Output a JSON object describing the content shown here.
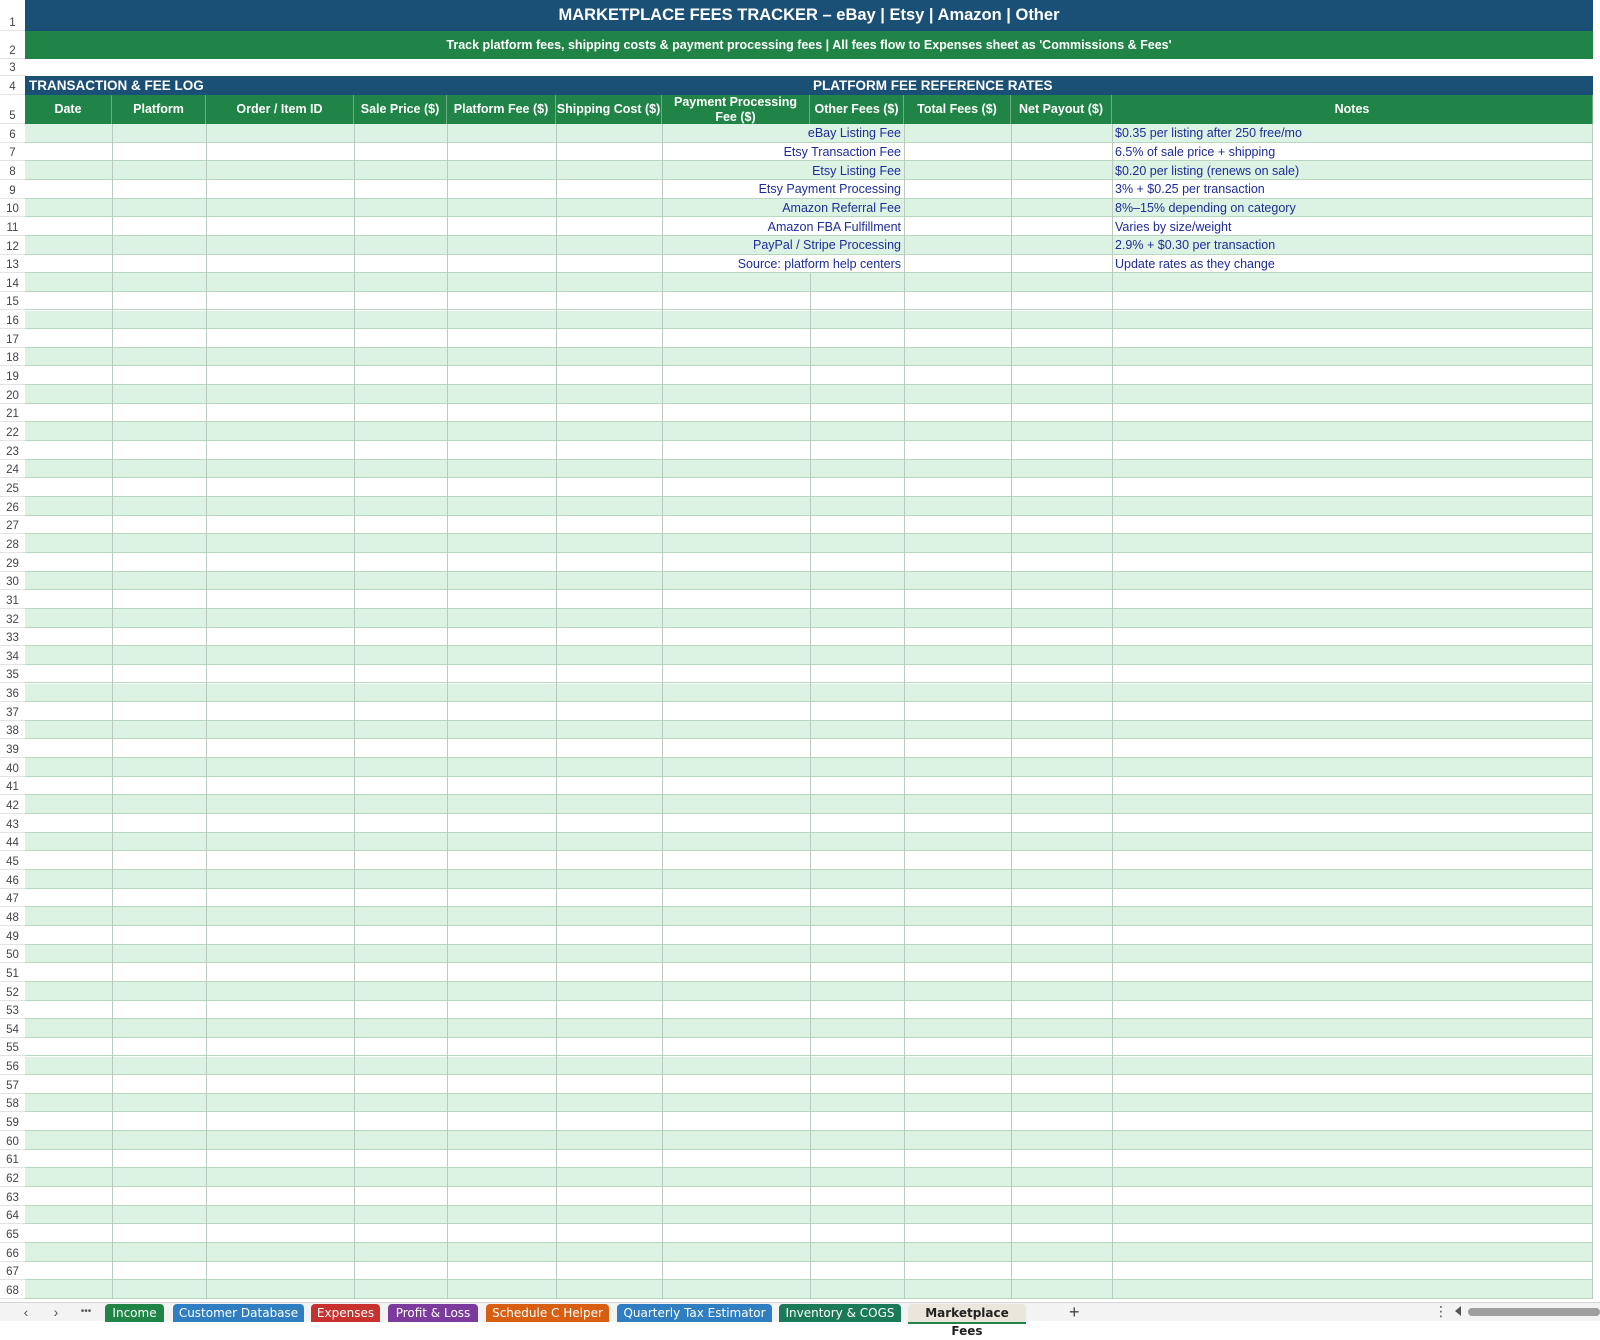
{
  "sheet": {
    "title": "MARKETPLACE FEES TRACKER – eBay | Etsy | Amazon | Other",
    "subtitle": "Track platform fees, shipping costs & payment processing fees  |  All fees flow to Expenses sheet as 'Commissions & Fees'",
    "section_left": "TRANSACTION & FEE LOG",
    "section_right": "PLATFORM FEE REFERENCE RATES",
    "columns": [
      "Date",
      "Platform",
      "Order / Item ID",
      "Sale Price ($)",
      "Platform Fee ($)",
      "Shipping Cost ($)",
      "Payment Processing Fee ($)",
      "Other Fees ($)",
      "Total Fees ($)",
      "Net Payout ($)",
      "Notes"
    ],
    "reference": [
      {
        "label": "eBay Listing Fee",
        "note": "$0.35 per listing after 250 free/mo"
      },
      {
        "label": "Etsy Transaction Fee",
        "note": "6.5% of sale price + shipping"
      },
      {
        "label": "Etsy Listing Fee",
        "note": "$0.20 per listing (renews on sale)"
      },
      {
        "label": "Etsy Payment Processing",
        "note": "3% + $0.25 per transaction"
      },
      {
        "label": "Amazon Referral Fee",
        "note": "8%–15% depending on category"
      },
      {
        "label": "Amazon FBA Fulfillment",
        "note": "Varies by size/weight"
      },
      {
        "label": "PayPal / Stripe Processing",
        "note": "2.9% + $0.30 per transaction"
      },
      {
        "label": "Source: platform help centers",
        "note": "Update rates as they change"
      }
    ],
    "row_numbers": [
      "1",
      "2",
      "3",
      "4",
      "5",
      "6",
      "7",
      "8",
      "9",
      "10",
      "11",
      "12",
      "13",
      "14",
      "15",
      "16",
      "17",
      "18",
      "19",
      "20",
      "21",
      "22",
      "23",
      "24",
      "25",
      "26",
      "27",
      "28",
      "29",
      "30",
      "31",
      "32",
      "33",
      "34",
      "35",
      "36",
      "37",
      "38",
      "39",
      "40",
      "41",
      "42",
      "43",
      "44",
      "45",
      "46",
      "47",
      "48",
      "49",
      "50",
      "51",
      "52",
      "53",
      "54",
      "55",
      "56",
      "57",
      "58",
      "59",
      "60",
      "61",
      "62",
      "63",
      "64",
      "65",
      "66",
      "67",
      "68"
    ],
    "band_color": "#dcf3e4"
  },
  "tabs": [
    {
      "label": "Income",
      "color": "#1f8446"
    },
    {
      "label": "Customer Database",
      "color": "#2e7ec1"
    },
    {
      "label": "Expenses",
      "color": "#c8322e"
    },
    {
      "label": "Profit & Loss",
      "color": "#7b3a9c"
    },
    {
      "label": "Schedule C Helper",
      "color": "#d85f12"
    },
    {
      "label": "Quarterly Tax Estimator",
      "color": "#2e7ec1"
    },
    {
      "label": "Inventory & COGS",
      "color": "#1a7a58"
    },
    {
      "label": "Marketplace Fees",
      "color": "#1f8446",
      "active": true
    }
  ],
  "tabbar": {
    "prev_icon": "‹",
    "next_icon": "›",
    "more_icon": "•••",
    "add_icon": "+",
    "options_icon": "⋮"
  }
}
